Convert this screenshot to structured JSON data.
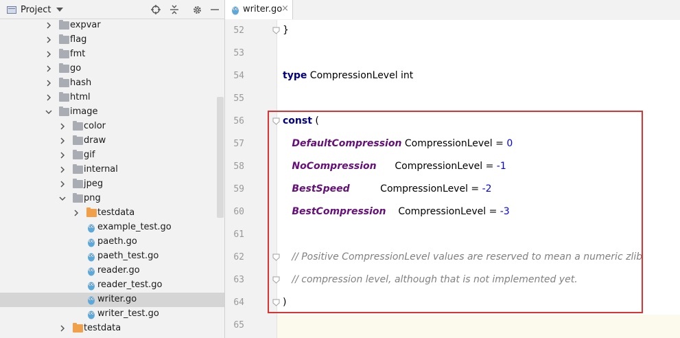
{
  "project_panel": {
    "title": "Project",
    "tree": [
      {
        "label": "expvar",
        "type": "folder",
        "expanded": false,
        "depth": 0
      },
      {
        "label": "flag",
        "type": "folder",
        "expanded": false,
        "depth": 0
      },
      {
        "label": "fmt",
        "type": "folder",
        "expanded": false,
        "depth": 0
      },
      {
        "label": "go",
        "type": "folder",
        "expanded": false,
        "depth": 0
      },
      {
        "label": "hash",
        "type": "folder",
        "expanded": false,
        "depth": 0
      },
      {
        "label": "html",
        "type": "folder",
        "expanded": false,
        "depth": 0
      },
      {
        "label": "image",
        "type": "folder",
        "expanded": true,
        "depth": 0
      },
      {
        "label": "color",
        "type": "folder",
        "expanded": false,
        "depth": 1
      },
      {
        "label": "draw",
        "type": "folder",
        "expanded": false,
        "depth": 1
      },
      {
        "label": "gif",
        "type": "folder",
        "expanded": false,
        "depth": 1
      },
      {
        "label": "internal",
        "type": "folder",
        "expanded": false,
        "depth": 1
      },
      {
        "label": "jpeg",
        "type": "folder",
        "expanded": false,
        "depth": 1
      },
      {
        "label": "png",
        "type": "folder",
        "expanded": true,
        "depth": 1
      },
      {
        "label": "testdata",
        "type": "folder-orange",
        "expanded": false,
        "depth": 2
      },
      {
        "label": "example_test.go",
        "type": "gofile",
        "depth": 2
      },
      {
        "label": "paeth.go",
        "type": "gofile",
        "depth": 2
      },
      {
        "label": "paeth_test.go",
        "type": "gofile",
        "depth": 2
      },
      {
        "label": "reader.go",
        "type": "gofile",
        "depth": 2
      },
      {
        "label": "reader_test.go",
        "type": "gofile",
        "depth": 2
      },
      {
        "label": "writer.go",
        "type": "gofile",
        "depth": 2,
        "selected": true
      },
      {
        "label": "writer_test.go",
        "type": "gofile",
        "depth": 2
      },
      {
        "label": "testdata",
        "type": "folder-orange",
        "expanded": false,
        "depth": 1
      }
    ]
  },
  "editor": {
    "tab": {
      "label": "writer.go",
      "close": "×"
    },
    "lines": [
      {
        "num": "52",
        "tokens": [
          {
            "t": "}",
            "c": "plain"
          }
        ],
        "fold": true
      },
      {
        "num": "53",
        "tokens": []
      },
      {
        "num": "54",
        "tokens": [
          {
            "t": "type",
            "c": "kw"
          },
          {
            "t": " CompressionLevel int",
            "c": "plain"
          }
        ]
      },
      {
        "num": "55",
        "tokens": []
      },
      {
        "num": "56",
        "tokens": [
          {
            "t": "const",
            "c": "kw"
          },
          {
            "t": " (",
            "c": "plain"
          }
        ],
        "fold": true
      },
      {
        "num": "57",
        "tokens": [
          {
            "t": "   ",
            "c": "plain"
          },
          {
            "t": "DefaultCompression",
            "c": "const-name"
          },
          {
            "t": " CompressionLevel = ",
            "c": "plain"
          },
          {
            "t": "0",
            "c": "num"
          }
        ]
      },
      {
        "num": "58",
        "tokens": [
          {
            "t": "   ",
            "c": "plain"
          },
          {
            "t": "NoCompression",
            "c": "const-name"
          },
          {
            "t": "      CompressionLevel = ",
            "c": "plain"
          },
          {
            "t": "-1",
            "c": "num"
          }
        ]
      },
      {
        "num": "59",
        "tokens": [
          {
            "t": "   ",
            "c": "plain"
          },
          {
            "t": "BestSpeed",
            "c": "const-name"
          },
          {
            "t": "          CompressionLevel = ",
            "c": "plain"
          },
          {
            "t": "-2",
            "c": "num"
          }
        ]
      },
      {
        "num": "60",
        "tokens": [
          {
            "t": "   ",
            "c": "plain"
          },
          {
            "t": "BestCompression",
            "c": "const-name"
          },
          {
            "t": "    CompressionLevel = ",
            "c": "plain"
          },
          {
            "t": "-3",
            "c": "num"
          }
        ]
      },
      {
        "num": "61",
        "tokens": []
      },
      {
        "num": "62",
        "tokens": [
          {
            "t": "   ",
            "c": "plain"
          },
          {
            "t": "// Positive CompressionLevel values are reserved to mean a numeric zlib",
            "c": "comment"
          }
        ],
        "fold": true
      },
      {
        "num": "63",
        "tokens": [
          {
            "t": "   ",
            "c": "plain"
          },
          {
            "t": "// compression level, although that is not implemented yet.",
            "c": "comment"
          }
        ],
        "fold": true
      },
      {
        "num": "64",
        "tokens": [
          {
            "t": ")",
            "c": "plain"
          }
        ],
        "fold": true
      },
      {
        "num": "65",
        "tokens": []
      }
    ]
  },
  "colors": {
    "keyword": "#000080",
    "constant": "#660e7a",
    "number": "#0000ff",
    "comment": "#808080",
    "annotation_box": "#e03131",
    "selection": "#d5d5d5"
  },
  "icons": {
    "project": "folder-icon",
    "dropdown": "chevron-down-icon",
    "locate": "crosshair-icon",
    "collapse": "collapse-all-icon",
    "settings": "gear-icon",
    "hide": "minimize-icon",
    "go_file": "gopher-file-icon"
  }
}
